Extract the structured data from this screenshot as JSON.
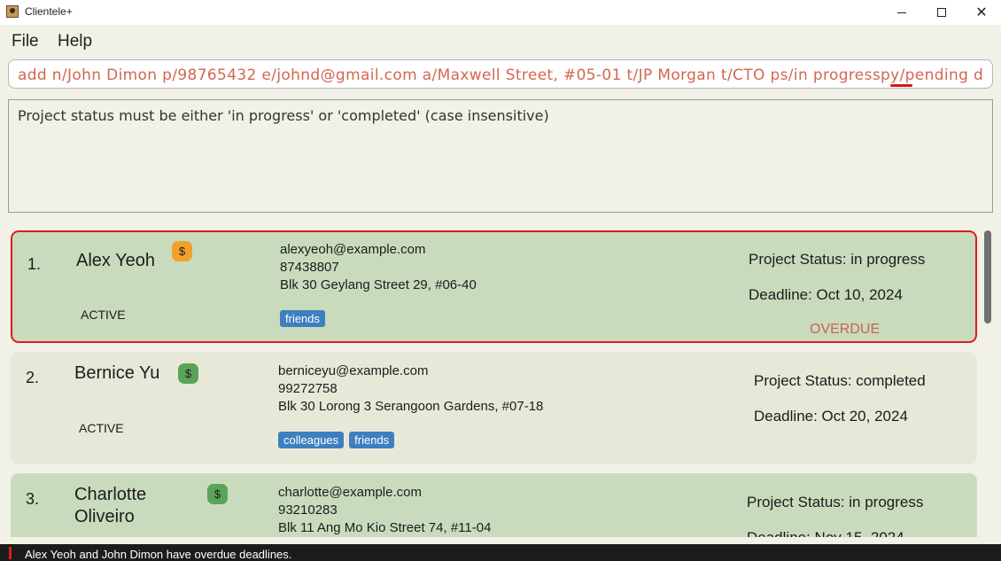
{
  "window": {
    "title": "Clientele+",
    "minimize_icon": "minimize-icon",
    "maximize_icon": "maximize-icon",
    "close_label": "✕"
  },
  "menu": {
    "file": "File",
    "help": "Help"
  },
  "command": {
    "value": "add n/John Dimon p/98765432 e/johnd@gmail.com a/Maxwell Street, #05-01 t/JP Morgan t/CTO ps/in progresspy/pending d"
  },
  "result": {
    "text": "Project status must be either 'in progress' or 'completed' (case insensitive)"
  },
  "persons": [
    {
      "index": "1.",
      "name": "Alex Yeoh",
      "badge": "$",
      "badge_color": "#f2a22a",
      "status": "ACTIVE",
      "email": "alexyeoh@example.com",
      "phone": "87438807",
      "address": "Blk 30 Geylang Street 29, #06-40",
      "tags": [
        "friends"
      ],
      "project_status": "Project Status: in progress",
      "deadline": "Deadline: Oct 10, 2024",
      "overdue": "OVERDUE"
    },
    {
      "index": "2.",
      "name": "Bernice Yu",
      "badge": "$",
      "badge_color": "#5aa35a",
      "status": "ACTIVE",
      "email": "berniceyu@example.com",
      "phone": "99272758",
      "address": "Blk 30 Lorong 3 Serangoon Gardens, #07-18",
      "tags": [
        "colleagues",
        "friends"
      ],
      "project_status": "Project Status: completed",
      "deadline": "Deadline: Oct 20, 2024"
    },
    {
      "index": "3.",
      "name": "Charlotte Oliveiro",
      "badge": "$",
      "badge_color": "#5aa35a",
      "email": "charlotte@example.com",
      "phone": "93210283",
      "address": "Blk 11 Ang Mo Kio Street 74, #11-04",
      "project_status": "Project Status: in progress",
      "deadline": "Deadline: Nov 15, 2024"
    }
  ],
  "statusbar": {
    "text": "Alex Yeoh and John Dimon have overdue deadlines."
  },
  "colors": {
    "card_green": "#c9dbbd",
    "card_beige": "#e8e8d9",
    "selected_border": "#e01b1b",
    "command_text": "#d2674f",
    "tag_bg": "#3e7fbf",
    "overdue_text": "#c96355"
  }
}
